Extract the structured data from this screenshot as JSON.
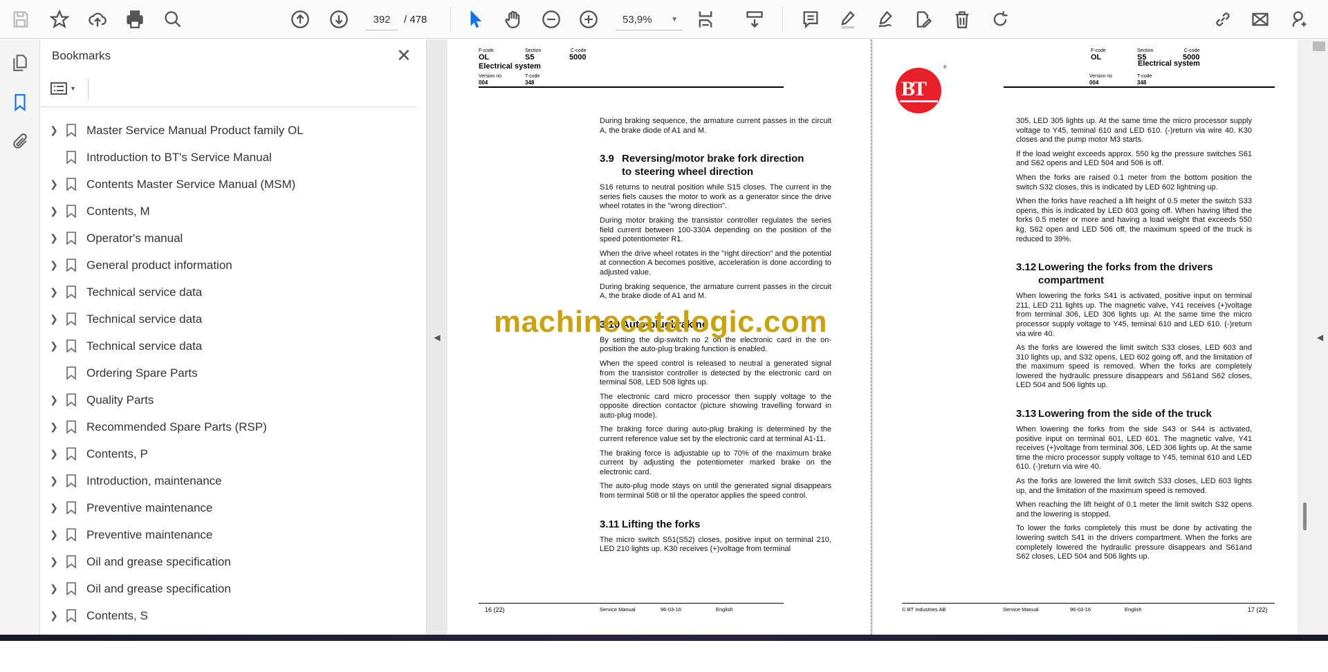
{
  "toolbar": {
    "icons": [
      "save-icon",
      "bookmark-star-icon",
      "upload-cloud-icon",
      "print-icon",
      "find-icon",
      "page-up-icon",
      "page-down-icon",
      "select-arrow-icon",
      "hand-icon",
      "zoom-out-icon",
      "zoom-in-icon",
      "fit-page-icon",
      "scroll-mode-icon",
      "comment-icon",
      "highlight-icon",
      "sign-icon",
      "edit-pdf-icon",
      "delete-icon",
      "rotate-icon",
      "share-link-icon",
      "email-icon",
      "add-user-icon"
    ],
    "current_page": "392",
    "total_pages": "/ 478",
    "zoom": "53,9%"
  },
  "panel": {
    "title": "Bookmarks",
    "items": [
      {
        "label": "Master Service Manual Product family OL",
        "expandable": true
      },
      {
        "label": "Introduction to BT's Service Manual",
        "expandable": false
      },
      {
        "label": "Contents Master Service Manual (MSM)",
        "expandable": true
      },
      {
        "label": "Contents, M",
        "expandable": true
      },
      {
        "label": "Operator's manual",
        "expandable": true
      },
      {
        "label": "General product information",
        "expandable": true
      },
      {
        "label": "Technical service data",
        "expandable": true
      },
      {
        "label": "Technical service data",
        "expandable": true
      },
      {
        "label": "Technical service data",
        "expandable": true
      },
      {
        "label": "Ordering Spare Parts",
        "expandable": false
      },
      {
        "label": "Quality Parts",
        "expandable": true
      },
      {
        "label": "Recommended Spare Parts (RSP)",
        "expandable": true
      },
      {
        "label": "Contents, P",
        "expandable": true
      },
      {
        "label": "Introduction, maintenance",
        "expandable": true
      },
      {
        "label": "Preventive maintenance",
        "expandable": true
      },
      {
        "label": "Preventive maintenance",
        "expandable": true
      },
      {
        "label": "Oil and grease specification",
        "expandable": true
      },
      {
        "label": "Oil and grease specification",
        "expandable": true
      },
      {
        "label": "Contents, S",
        "expandable": true
      }
    ]
  },
  "header": {
    "fcode_label": "F-code",
    "fcode": "OL",
    "section_label": "Section",
    "section": "S5",
    "ccode_label": "C-code",
    "ccode": "5000",
    "title": "Electrical system",
    "version_label": "Version no",
    "version": "004",
    "tcode_label": "T-code",
    "tcode": "348"
  },
  "left_page": {
    "blocks": [
      {
        "type": "p",
        "text": "During braking sequence, the armature current passes in the circuit A, the brake diode of A1 and M."
      },
      {
        "type": "h",
        "num": "3.9",
        "text": "Reversing/motor brake fork direction",
        "text2": "to steering wheel direction"
      },
      {
        "type": "p",
        "text": "S16 returns to neutral position while S15 closes. The current in the series fiels causes the motor to work as a generator since the drive wheel rotates in the \"wrong direction\"."
      },
      {
        "type": "p",
        "text": "During motor braking the transistor controller regulates the series field current between 100-330A depending on the position of the speed potentiometer R1."
      },
      {
        "type": "p",
        "text": "When the drive wheel rotates in the \"right direction\" and the potential at connection A becomes positive, acceleration is done according to adjusted value."
      },
      {
        "type": "p",
        "text": "During braking sequence, the armature current passes in the circuit A, the brake diode of A1 and M."
      },
      {
        "type": "h",
        "num": "3.10",
        "text": "Auto-plugbraking"
      },
      {
        "type": "p",
        "text": "By setting the dip-switch no 2 on the electronic card in the on-position the auto-plug braking function is enabled."
      },
      {
        "type": "p",
        "text": "When the speed control is released to neutral a generated signal from the transistor controller is detected by the electronic card on terminal 508, LED 508 lights up."
      },
      {
        "type": "p",
        "text": "The electronic card micro processor then supply voltage to the opposite direction contactor (picture showing travelling forward in auto-plug mode)."
      },
      {
        "type": "p",
        "text": "The braking force during auto-plug braking is determined by the current reference value set by the electronic card at terminal A1-11."
      },
      {
        "type": "p",
        "text": "The braking force is adjustable up to 70% of the maximum brake current by adjusting the potentiometer marked brake on the electronic card."
      },
      {
        "type": "p",
        "text": "The auto-plug mode stays on until the generated signal disappears from terminal 508 or til the operator applies the speed control."
      },
      {
        "type": "h",
        "num": "3.11",
        "text": "Lifting the forks"
      },
      {
        "type": "p",
        "text": "The micro switch S51(S52) closes, positive input on terminal 210, LED 210 lights up. K30 receives (+)voltage from terminal"
      }
    ],
    "footer": {
      "page": "16 (22)",
      "doc": "Service Manual",
      "date": "96-03-16",
      "lang": "English"
    }
  },
  "right_page": {
    "logo_text": "BT",
    "logo_mark": "®",
    "blocks": [
      {
        "type": "p",
        "text": "305, LED 305 lights up. At the same time the micro processor supply voltage to Y45, teminal 610 and LED 610. (-)return via wire 40. K30 closes and the pump motor M3 starts."
      },
      {
        "type": "p",
        "text": "If the load weight exceeds approx. 550 kg the pressure switches S61 and S62 opens and LED 504 and 506 is off."
      },
      {
        "type": "p",
        "text": "When the forks are raised 0.1 meter from the bottom position the switch S32 closes, this is indicated by LED 602 lightning up."
      },
      {
        "type": "p",
        "text": "When the forks have reached a lift height of 0.5 meter the switch S33 opens, this is indicated by LED 603 going off. When having lifted the forks 0.5 meter or more and having a load weight that exceeds 550 kg, S62 open and LED 506 off, the maximum speed of the truck is reduced to 39%."
      },
      {
        "type": "h",
        "num": "3.12",
        "text": "Lowering the forks from the drivers",
        "text2": "compartment"
      },
      {
        "type": "p",
        "text": "When lowering the forks S41 is activated, positive input on terminal 211, LED 211 lights up. The magnetic valve, Y41 receives (+)voltage from terminal 306, LED 306 lights up. At the same time the micro processor supply voltage to Y45, teminal 610 and LED 610. (-)return via wire 40."
      },
      {
        "type": "p",
        "text": "As the forks are lowered the limit switch S33 closes, LED 603 and 310 lights up, and S32 opens, LED 602 going off, and the limitation of the maximum speed is removed. When the forks are completely lowered the hydraulic pressure disappears and S61and S62 closes, LED 504 and 506 lights up."
      },
      {
        "type": "h",
        "num": "3.13",
        "text": "Lowering from the side of the truck"
      },
      {
        "type": "p",
        "text": "When lowering the forks from the side S43 or S44 is activated, positive input on terminal 601, LED 601. The magnetic valve, Y41 receives (+)voltage from terminal 306, LED 306 lights up. At the same time the micro processor supply voltage to Y45, teminal 610 and LED 610. (-)return via wire 40."
      },
      {
        "type": "p",
        "text": "As the forks are lowered the limit switch S33 closes, LED 603 lights up, and the limitation of the maximum speed is removed."
      },
      {
        "type": "p",
        "text": "When reaching the lift height of 0.1 meter the limit switch S32 opens and the lowering is stopped."
      },
      {
        "type": "p",
        "text": "To lower the forks completely this must be done by activating the lowering switch S41 in the drivers compartment. When the forks are completely lowered the hydraulic pressure disappears and S61and S62 closes, LED 504 and 506 lights up."
      }
    ],
    "footer": {
      "copyright": "© BT Industries AB",
      "doc": "Service Manual",
      "date": "96-03-16",
      "lang": "English",
      "page": "17 (22)"
    }
  },
  "watermark": "machinecatalogic.com",
  "colors": {
    "accent": "#1473e6",
    "watermark": "#c9a20f",
    "logo": "#e8202a"
  }
}
